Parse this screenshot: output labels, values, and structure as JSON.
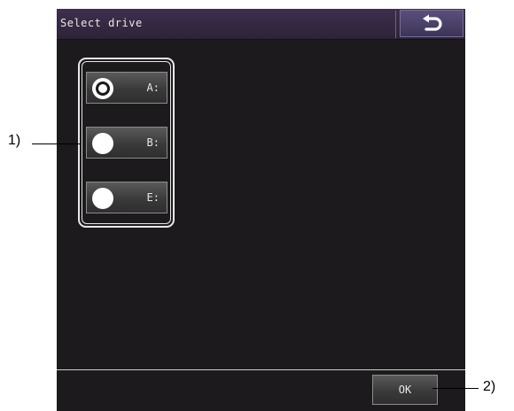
{
  "title": "Select drive",
  "back_icon": "undo-arrow-icon",
  "drives": [
    {
      "label": "A:",
      "selected": true
    },
    {
      "label": "B:",
      "selected": false
    },
    {
      "label": "E:",
      "selected": false
    }
  ],
  "ok_label": "OK",
  "callouts": {
    "one": "1)",
    "two": "2)"
  },
  "colors": {
    "screen_bg": "#1c1a1c",
    "titlebar": "#3e2f4c",
    "back_button": "#5b4f7a",
    "text": "#e8e8e8"
  }
}
